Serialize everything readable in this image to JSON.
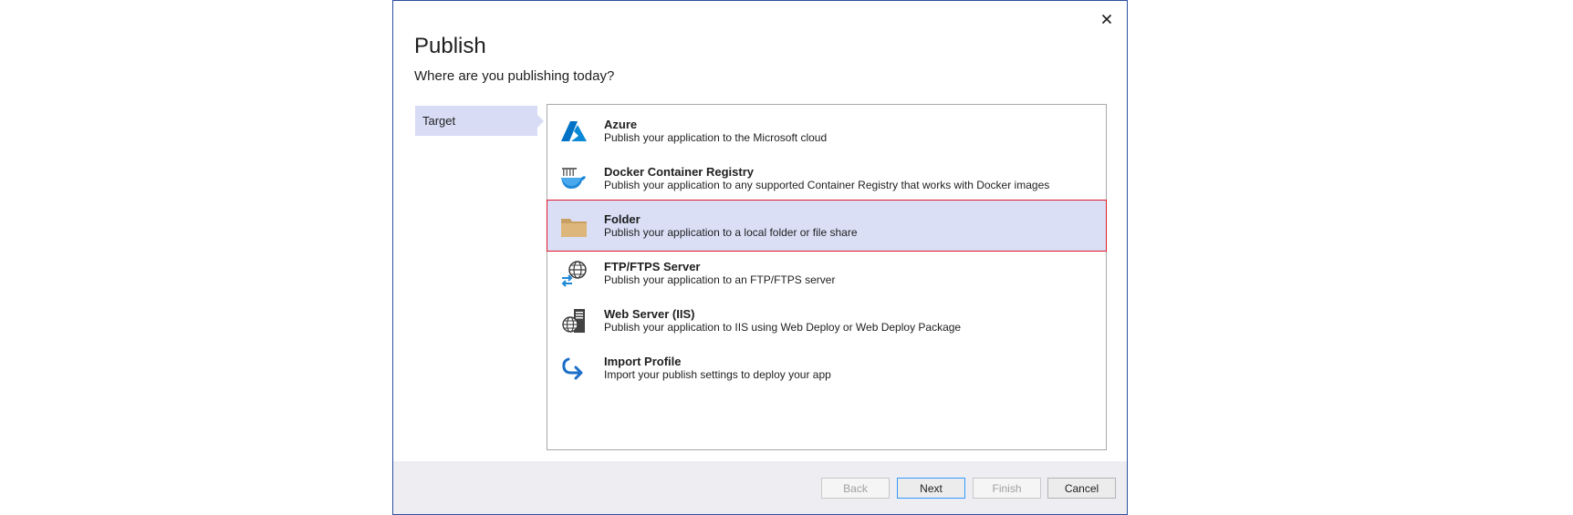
{
  "dialog": {
    "title": "Publish",
    "subtitle": "Where are you publishing today?",
    "close_icon": "close-icon"
  },
  "steps": [
    {
      "label": "Target",
      "active": true
    }
  ],
  "targets": [
    {
      "title": "Azure",
      "description": "Publish your application to the Microsoft cloud",
      "icon": "azure-icon",
      "selected": false
    },
    {
      "title": "Docker Container Registry",
      "description": "Publish your application to any supported Container Registry that works with Docker images",
      "icon": "docker-icon",
      "selected": false
    },
    {
      "title": "Folder",
      "description": "Publish your application to a local folder or file share",
      "icon": "folder-icon",
      "selected": true
    },
    {
      "title": "FTP/FTPS Server",
      "description": "Publish your application to an FTP/FTPS server",
      "icon": "ftp-globe-icon",
      "selected": false
    },
    {
      "title": "Web Server (IIS)",
      "description": "Publish your application to IIS using Web Deploy or Web Deploy Package",
      "icon": "web-server-icon",
      "selected": false
    },
    {
      "title": "Import Profile",
      "description": "Import your publish settings to deploy your app",
      "icon": "import-icon",
      "selected": false
    }
  ],
  "footer": {
    "back_label": "Back",
    "next_label": "Next",
    "finish_label": "Finish",
    "cancel_label": "Cancel"
  },
  "colors": {
    "accent_blue": "#0078d4",
    "selection_bg": "#dadff6",
    "selection_border": "#e0182b",
    "step_bg": "#d8dcf5",
    "folder_tan": "#dcb67a"
  }
}
